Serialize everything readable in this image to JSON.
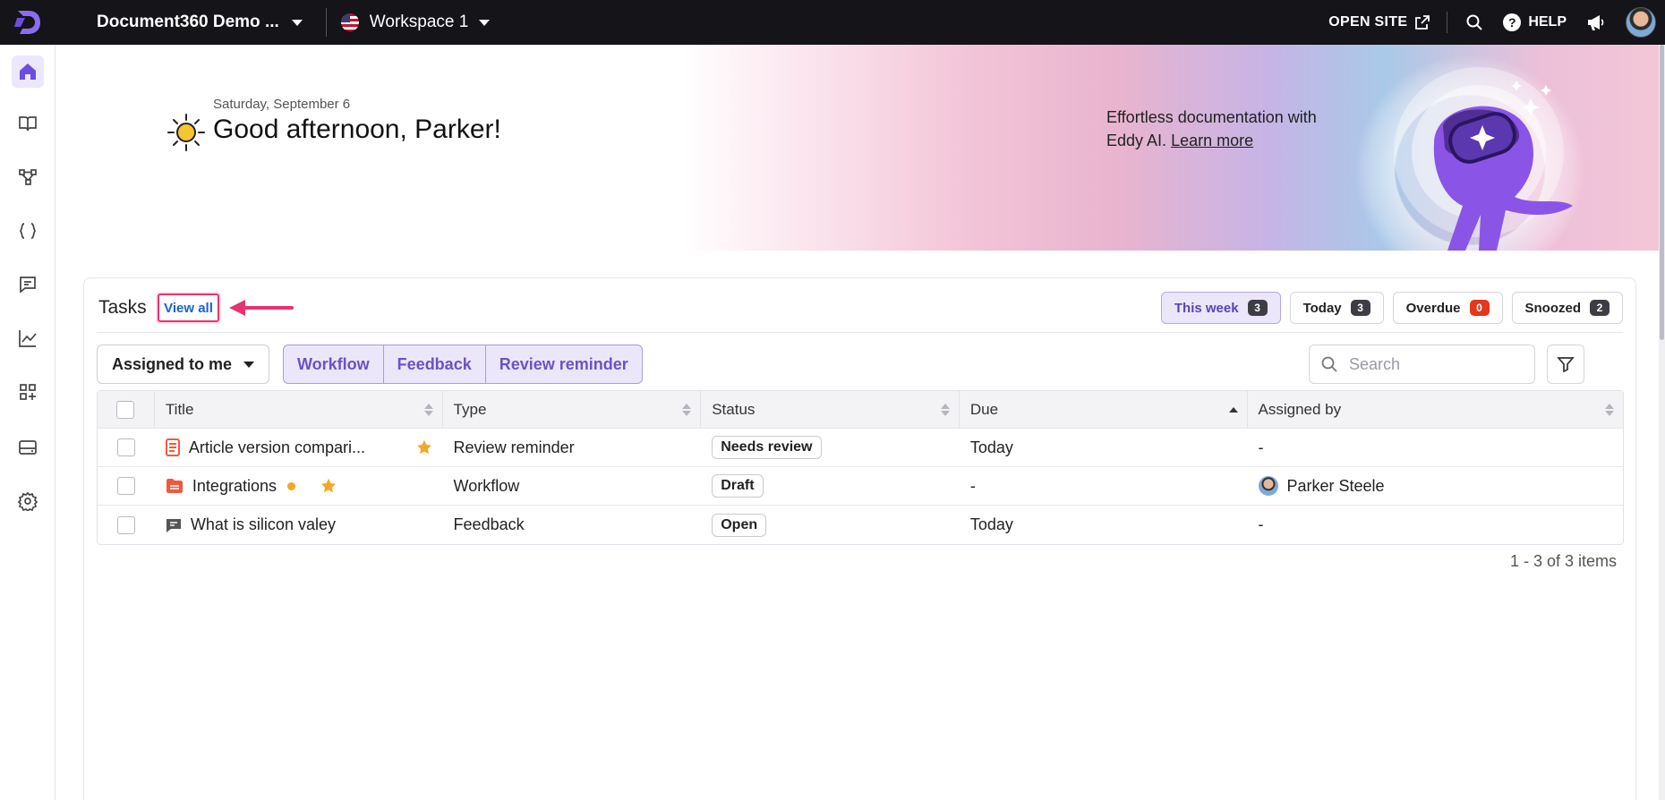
{
  "topbar": {
    "project_name": "Document360 Demo ...",
    "workspace": "Workspace 1",
    "open_site": "OPEN SITE",
    "help": "HELP"
  },
  "sidebar": {
    "items": [
      {
        "icon": "home-icon",
        "active": true
      },
      {
        "icon": "book-icon"
      },
      {
        "icon": "hierarchy-icon"
      },
      {
        "icon": "code-braces-icon"
      },
      {
        "icon": "comment-icon"
      },
      {
        "icon": "analytics-icon"
      },
      {
        "icon": "apps-add-icon"
      },
      {
        "icon": "drive-icon"
      },
      {
        "icon": "gear-icon"
      }
    ]
  },
  "hero": {
    "date": "Saturday, September 6",
    "greeting": "Good afternoon, Parker!",
    "eddy_text": "Effortless documentation with Eddy AI.",
    "learn_more": "Learn more"
  },
  "tasks": {
    "title": "Tasks",
    "view_all": "View all",
    "filters": [
      {
        "label": "This week",
        "count": "3",
        "active": true
      },
      {
        "label": "Today",
        "count": "3"
      },
      {
        "label": "Overdue",
        "count": "0",
        "alert": true
      },
      {
        "label": "Snoozed",
        "count": "2"
      }
    ],
    "assigned_dropdown": "Assigned to me",
    "type_segments": [
      "Workflow",
      "Feedback",
      "Review reminder"
    ],
    "search_placeholder": "Search",
    "columns": [
      "Title",
      "Type",
      "Status",
      "Due",
      "Assigned by"
    ],
    "rows": [
      {
        "title": "Article version compari...",
        "icon": "article-icon",
        "starred": true,
        "dot": false,
        "type": "Review reminder",
        "status": "Needs review",
        "due": "Today",
        "assigned_by": "-"
      },
      {
        "title": "Integrations",
        "icon": "folder-icon",
        "starred": true,
        "dot": true,
        "type": "Workflow",
        "status": "Draft",
        "due": "-",
        "assigned_by": "Parker Steele"
      },
      {
        "title": "What is silicon valey",
        "icon": "feedback-icon",
        "starred": false,
        "dot": false,
        "type": "Feedback",
        "status": "Open",
        "due": "Today",
        "assigned_by": "-"
      }
    ],
    "pagination": "1 - 3 of 3 items"
  },
  "colors": {
    "accent": "#7b5ce0",
    "topbar": "#141419",
    "highlight": "#e8336f",
    "link": "#1b5fd6"
  }
}
